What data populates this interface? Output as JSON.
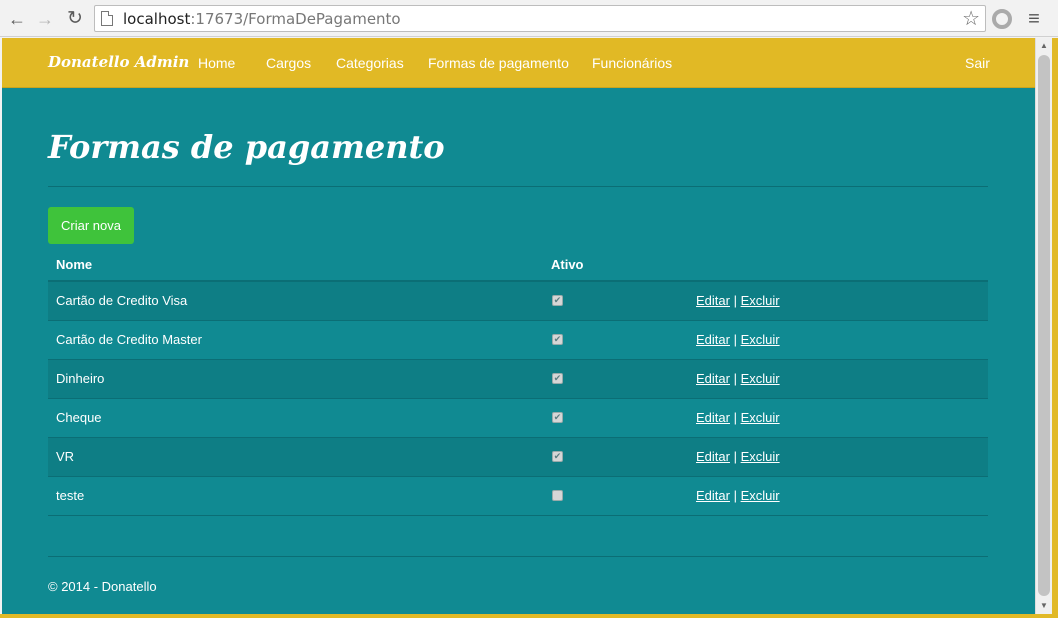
{
  "browser": {
    "url_host": "localhost",
    "url_path": ":17673/FormaDePagamento",
    "back_glyph": "←",
    "forward_glyph": "→",
    "reload_glyph": "↻",
    "star_glyph": "☆",
    "menu_glyph": "≡"
  },
  "navbar": {
    "brand": "Donatello Admin",
    "links": [
      "Home",
      "Cargos",
      "Categorias",
      "Formas de pagamento",
      "Funcionários"
    ],
    "logout": "Sair",
    "color": "#e1b925"
  },
  "page": {
    "title": "Formas de pagamento",
    "create_button": "Criar nova",
    "background": "#108a92",
    "button_color": "#3fc33b"
  },
  "table": {
    "headers": {
      "nome": "Nome",
      "ativo": "Ativo"
    },
    "edit_label": "Editar",
    "delete_label": "Excluir",
    "separator": "|",
    "rows": [
      {
        "nome": "Cartão de Credito Visa",
        "ativo": true,
        "check": "✔"
      },
      {
        "nome": "Cartão de Credito Master",
        "ativo": true,
        "check": "✔"
      },
      {
        "nome": "Dinheiro",
        "ativo": true,
        "check": "✔"
      },
      {
        "nome": "Cheque",
        "ativo": true,
        "check": "✔"
      },
      {
        "nome": "VR",
        "ativo": true,
        "check": "✔"
      },
      {
        "nome": "teste",
        "ativo": false,
        "check": ""
      }
    ]
  },
  "footer": {
    "text": "© 2014 - Donatello"
  }
}
